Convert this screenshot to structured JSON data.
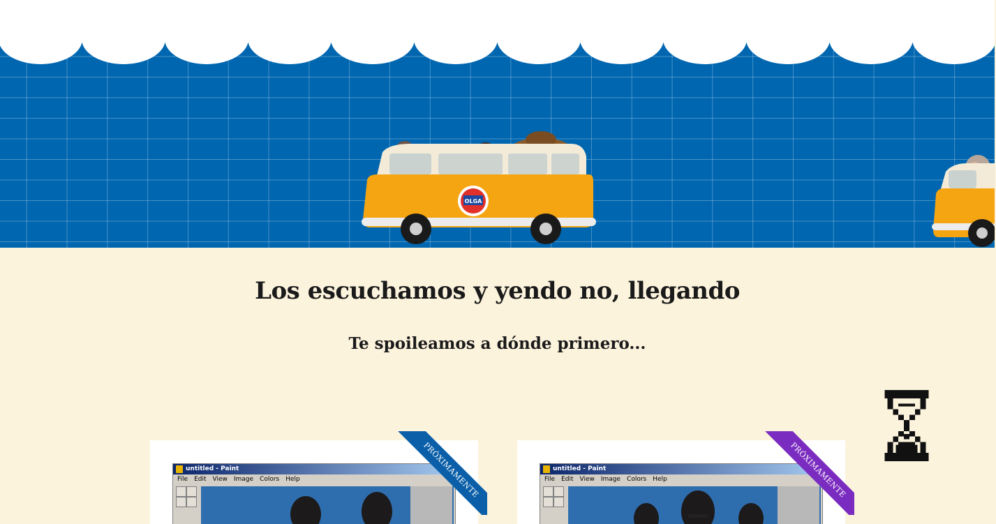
{
  "hero": {
    "background_color": "#0066b0",
    "van_logo_text": "OLGA"
  },
  "main": {
    "title": "Los escuchamos y yendo no, llegando",
    "subtitle": "Te spoileamos a dónde primero..."
  },
  "cards": [
    {
      "ribbon_label": "PRÓXIMAMENTE",
      "ribbon_color": "#0a5fa8",
      "window_title": "untitled - Paint",
      "menu": [
        "File",
        "Edit",
        "View",
        "Image",
        "Colors",
        "Help"
      ]
    },
    {
      "ribbon_label": "PRÓXIMAMENTE",
      "ribbon_color": "#7b2cc0",
      "window_title": "untitled - Paint",
      "menu": [
        "File",
        "Edit",
        "View",
        "Image",
        "Colors",
        "Help"
      ]
    }
  ],
  "icons": {
    "hourglass": "hourglass-icon"
  }
}
